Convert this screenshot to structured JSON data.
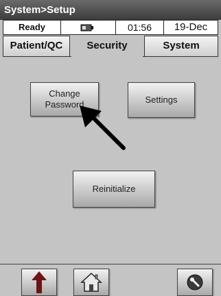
{
  "window": {
    "title": "System>Setup"
  },
  "status": {
    "state": "Ready",
    "time": "01:56",
    "date": "19-Dec",
    "icon": "battery-icon"
  },
  "tabs": [
    {
      "label": "Patient/QC",
      "active": false
    },
    {
      "label": "Security",
      "active": true
    },
    {
      "label": "System",
      "active": false
    }
  ],
  "buttons": {
    "change_password_line1": "Change",
    "change_password_line2": "Password",
    "settings": "Settings",
    "reinitialize": "Reinitialize"
  },
  "nav": {
    "up_icon": "up-arrow-icon",
    "home_icon": "home-icon",
    "tools_icon": "wrench-icon"
  },
  "colors": {
    "title_bar": "#4a4a4a",
    "background": "#c4c4c4",
    "up_arrow": "#6e1414"
  }
}
